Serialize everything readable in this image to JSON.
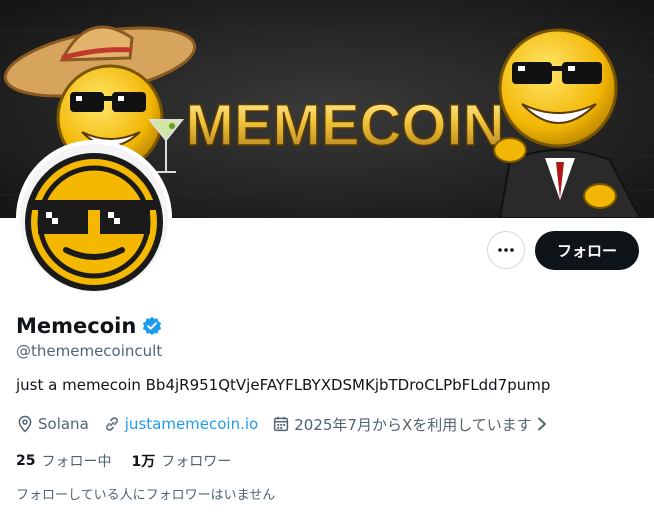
{
  "banner": {
    "title_text": "MEMECOIN"
  },
  "actions": {
    "more_label": "…",
    "follow_label": "フォロー"
  },
  "profile": {
    "display_name": "Memecoin",
    "handle": "@thememecoincult",
    "bio": "just a memecoin Bb4jR951QtVjeFAYFLBYXDSMKjbTDroCLPbFLdd7pump",
    "location": "Solana",
    "website": "justamemecoin.io",
    "joined": "2025年7月からXを利用しています"
  },
  "stats": {
    "following_count": "25",
    "following_label": "フォロー中",
    "followers_count": "1万",
    "followers_label": "フォロワー"
  },
  "followers_you_know": "フォローしている人にフォロワーはいません",
  "colors": {
    "accent": "#1d9bf0",
    "primary_button": "#0f1419",
    "secondary_text": "#536471",
    "coin_yellow": "#f5c518"
  },
  "icons": {
    "location": "location-pin-icon",
    "link": "link-icon",
    "calendar": "calendar-icon",
    "verified": "verified-badge-icon",
    "more": "more-dots-icon",
    "chevron": "chevron-right-icon"
  }
}
